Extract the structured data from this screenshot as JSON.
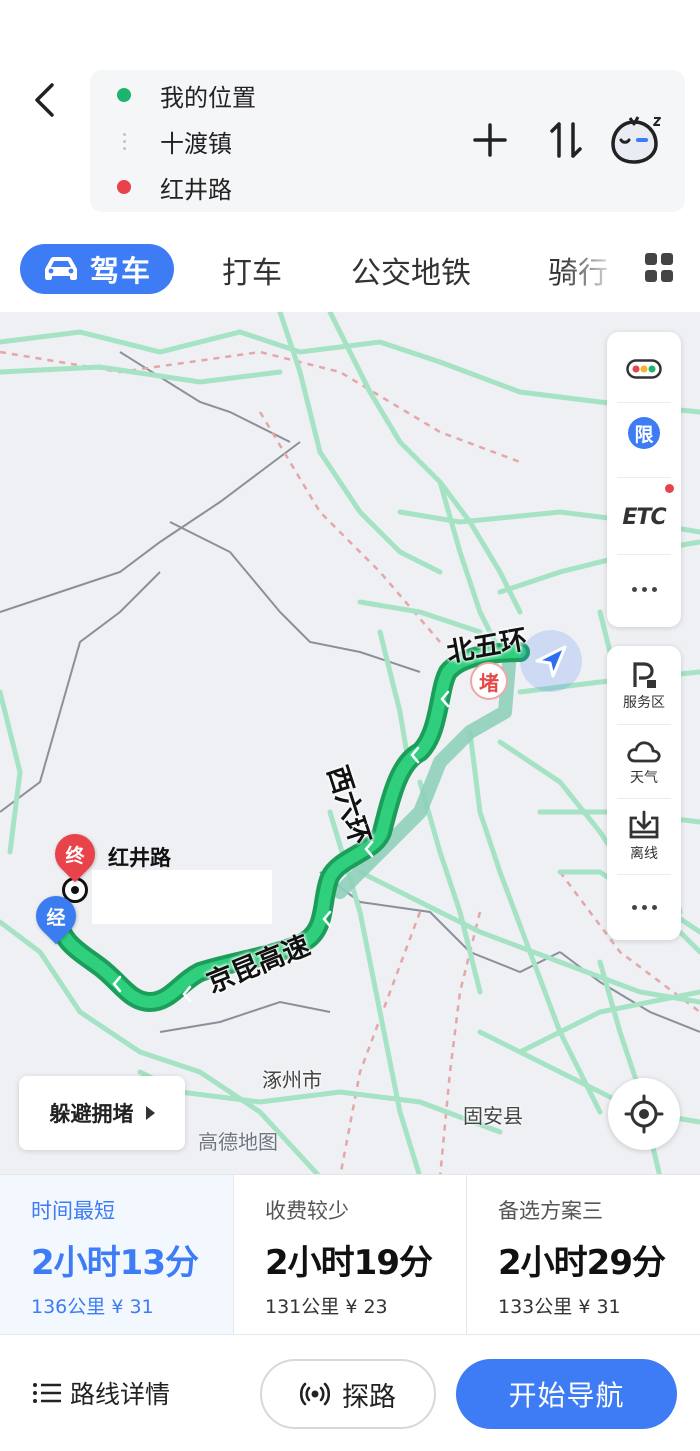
{
  "header": {
    "back_icon": "chevron-left-icon",
    "waypoints": [
      {
        "label": "我的位置",
        "dot_color": "#1db56b"
      },
      {
        "label": "十渡镇"
      },
      {
        "label": "红井路",
        "dot_color": "#e8434a"
      }
    ],
    "add_icon": "plus-icon",
    "swap_icon": "swap-arrows-icon",
    "assistant_icon": "sleepy-assistant-icon"
  },
  "tabs": [
    {
      "label": "驾车",
      "active": true,
      "icon": "car-icon"
    },
    {
      "label": "打车"
    },
    {
      "label": "公交地铁"
    },
    {
      "label": "骑行"
    }
  ],
  "map": {
    "roads": [
      "北五环",
      "西六环",
      "京昆高速"
    ],
    "places": [
      "涿州市",
      "固安县"
    ],
    "watermark": "高德地图",
    "destination_label": "红井路",
    "markers": {
      "end": "终",
      "via": "经",
      "jam": "堵"
    },
    "controls": {
      "traffic_icon": "traffic-light-icon",
      "restriction": "限",
      "etc": "ETC",
      "service_area": "服务区",
      "weather": "天气",
      "offline": "离线"
    },
    "avoid_congestion": "躲避拥堵",
    "locate_icon": "locate-crosshair-icon",
    "route_color": "#1db56b",
    "alt_route_color": "#8fd0bb"
  },
  "routes": [
    {
      "name": "时间最短",
      "time": "2小时13分",
      "distance": "136公里",
      "toll": "¥ 31",
      "selected": true
    },
    {
      "name": "收费较少",
      "time": "2小时19分",
      "distance": "131公里",
      "toll": "¥ 23"
    },
    {
      "name": "备选方案三",
      "time": "2小时29分",
      "distance": "133公里",
      "toll": "¥ 31"
    }
  ],
  "bottom": {
    "details": "路线详情",
    "explore": "探路",
    "start_nav": "开始导航"
  },
  "colors": {
    "accent": "#3d7cf5",
    "route_green": "#1db56b",
    "danger": "#e8434a"
  }
}
